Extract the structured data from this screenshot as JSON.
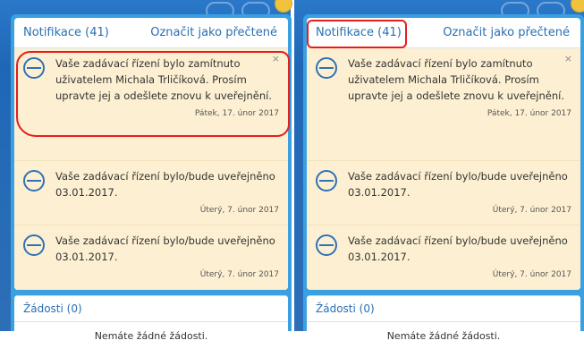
{
  "colors": {
    "accent": "#2a6fb3",
    "panel_border": "#3aa0e2",
    "notification_bg": "#fdf0d2",
    "annotation": "#e61d1d"
  },
  "panels": [
    {
      "header": {
        "title": "Notifikace (41)",
        "mark_all": "Označit jako přečtené"
      },
      "notifications": [
        {
          "message": "Vaše zadávací řízení bylo zamítnuto uživatelem Michala Trličíková. Prosím upravte jej a odešlete znovu k uveřejnění.",
          "date": "Pátek, 17. únor 2017",
          "close_icon": "×"
        },
        {
          "message": "Vaše zadávací řízení bylo/bude uveřejněno 03.01.2017.",
          "date": "Úterý, 7. únor 2017"
        },
        {
          "message": "Vaše zadávací řízení bylo/bude uveřejněno 03.01.2017.",
          "date": "Úterý, 7. únor 2017"
        }
      ],
      "requests": {
        "title": "Žádosti (0)",
        "empty": "Nemáte žádné žádosti."
      }
    },
    {
      "header": {
        "title": "Notifikace (41)",
        "mark_all": "Označit jako přečtené"
      },
      "notifications": [
        {
          "message": "Vaše zadávací řízení bylo zamítnuto uživatelem Michala Trličíková. Prosím upravte jej a odešlete znovu k uveřejnění.",
          "date": "Pátek, 17. únor 2017",
          "close_icon": "×"
        },
        {
          "message": "Vaše zadávací řízení bylo/bude uveřejněno 03.01.2017.",
          "date": "Úterý, 7. únor 2017"
        },
        {
          "message": "Vaše zadávací řízení bylo/bude uveřejněno 03.01.2017.",
          "date": "Úterý, 7. únor 2017"
        }
      ],
      "requests": {
        "title": "Žádosti (0)",
        "empty": "Nemáte žádné žádosti."
      }
    }
  ]
}
